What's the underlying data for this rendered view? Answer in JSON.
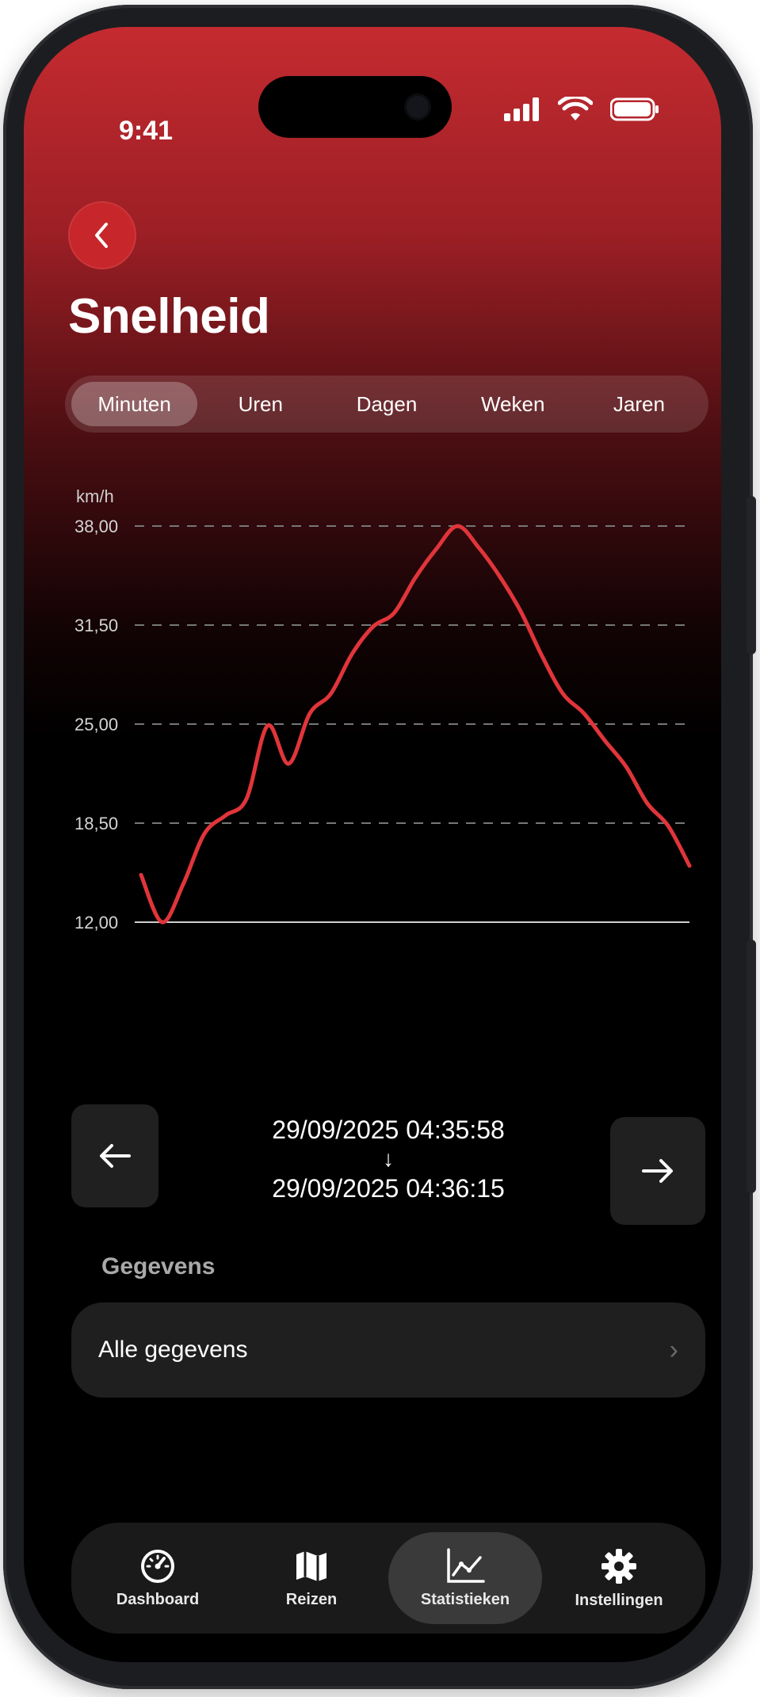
{
  "status": {
    "time": "9:41"
  },
  "header": {
    "title": "Snelheid"
  },
  "segments": [
    {
      "label": "Minuten",
      "active": true
    },
    {
      "label": "Uren",
      "active": false
    },
    {
      "label": "Dagen",
      "active": false
    },
    {
      "label": "Weken",
      "active": false
    },
    {
      "label": "Jaren",
      "active": false
    }
  ],
  "chart_data": {
    "type": "line",
    "ylabel": "km/h",
    "y_ticks": [
      "38,00",
      "31,50",
      "25,00",
      "18,50",
      "12,00"
    ],
    "ylim": [
      12,
      38
    ],
    "y_tick_values": [
      38,
      31.5,
      25,
      18.5,
      12
    ],
    "grid": true,
    "series_color": "#e0353a",
    "values": [
      15.1,
      12.0,
      14.5,
      17.8,
      19.0,
      20.1,
      24.9,
      22.4,
      25.7,
      27.0,
      29.6,
      31.4,
      32.3,
      34.6,
      36.5,
      38.0,
      36.6,
      34.7,
      32.4,
      29.5,
      27.0,
      25.7,
      23.9,
      22.2,
      19.8,
      18.3,
      15.7
    ]
  },
  "range": {
    "start": "29/09/2025 04:35:58",
    "arrow": "↓",
    "end": "29/09/2025 04:36:15"
  },
  "data_section": {
    "label": "Gegevens",
    "items": [
      {
        "label": "Alle gegevens"
      }
    ]
  },
  "tabbar": {
    "items": [
      {
        "label": "Dashboard",
        "icon": "speedometer-icon",
        "active": false
      },
      {
        "label": "Reizen",
        "icon": "map-icon",
        "active": false
      },
      {
        "label": "Statistieken",
        "icon": "chart-icon",
        "active": true
      },
      {
        "label": "Instellingen",
        "icon": "gear-icon",
        "active": false
      }
    ]
  },
  "colors": {
    "accent": "#c7262b",
    "line": "#e0353a",
    "background": "#000000"
  }
}
